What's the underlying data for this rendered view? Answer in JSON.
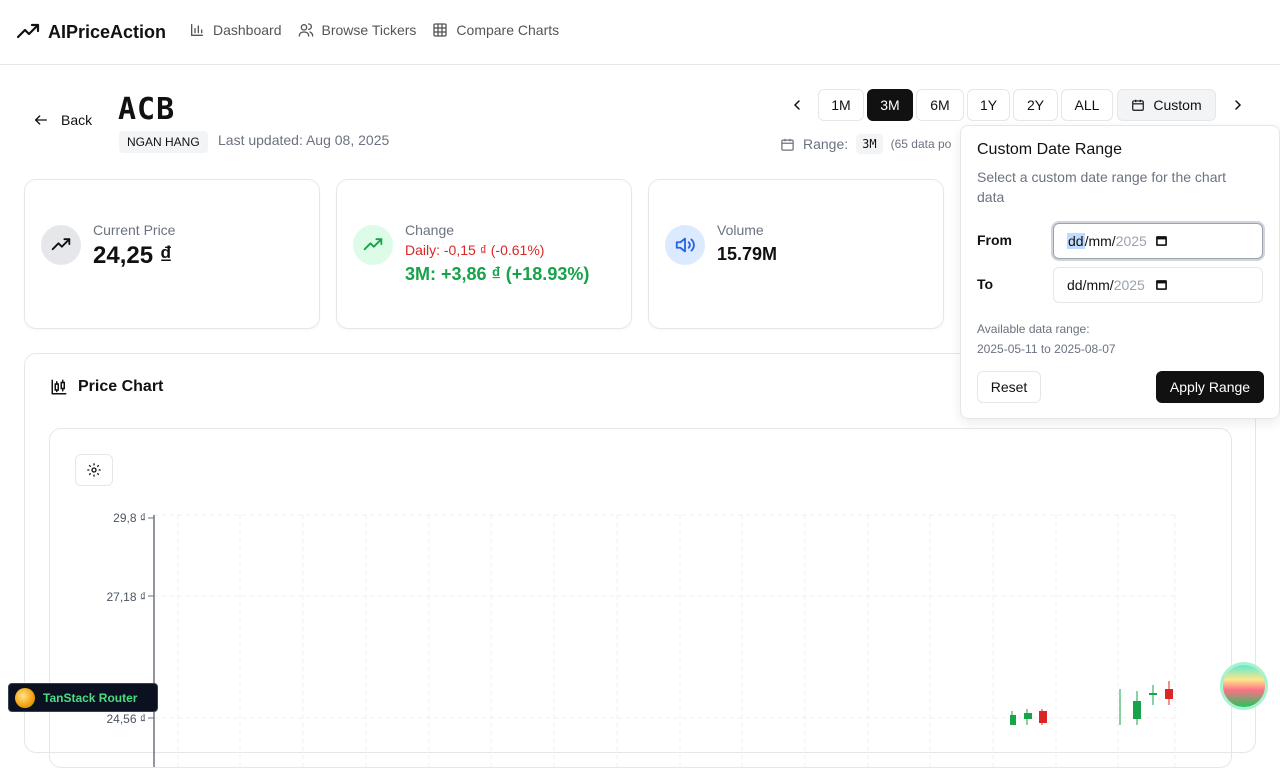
{
  "app": {
    "brand": "AIPriceAction",
    "nav": [
      {
        "label": "Dashboard",
        "icon": "bar-chart-icon"
      },
      {
        "label": "Browse Tickers",
        "icon": "users-icon"
      },
      {
        "label": "Compare Charts",
        "icon": "table-grid-icon"
      }
    ]
  },
  "header": {
    "back_label": "Back",
    "ticker": "ACB",
    "sector": "NGAN HANG",
    "last_updated": "Last updated: Aug 08, 2025"
  },
  "range": {
    "options": [
      "1M",
      "3M",
      "6M",
      "1Y",
      "2Y",
      "ALL"
    ],
    "active": "3M",
    "custom_label": "Custom",
    "range_label": "Range:",
    "range_value": "3M",
    "range_points": "(65 data po"
  },
  "cards": {
    "price": {
      "label": "Current Price",
      "value": "24,25 ₫"
    },
    "change": {
      "label": "Change",
      "daily": "Daily: -0,15 ₫ (-0.61%)",
      "period": "3M: +3,86 ₫ (+18.93%)"
    },
    "volume": {
      "label": "Volume",
      "value": "15.79M"
    }
  },
  "chart": {
    "title": "Price Chart",
    "y_ticks": [
      "29,8 ₫",
      "27,18 ₫",
      "24,56 ₫"
    ]
  },
  "popover": {
    "title": "Custom Date Range",
    "description": "Select a custom date range for the chart data",
    "from_label": "From",
    "to_label": "To",
    "date_day": "dd",
    "date_rest": "/mm/",
    "date_year": "2025",
    "available_label": "Available data range:",
    "available_range": "2025-05-11 to 2025-08-07",
    "reset_label": "Reset",
    "apply_label": "Apply Range"
  },
  "devtools": {
    "label": "TanStack Router"
  },
  "colors": {
    "accent": "#111111",
    "negative": "#dc2626",
    "positive": "#16a34a"
  }
}
